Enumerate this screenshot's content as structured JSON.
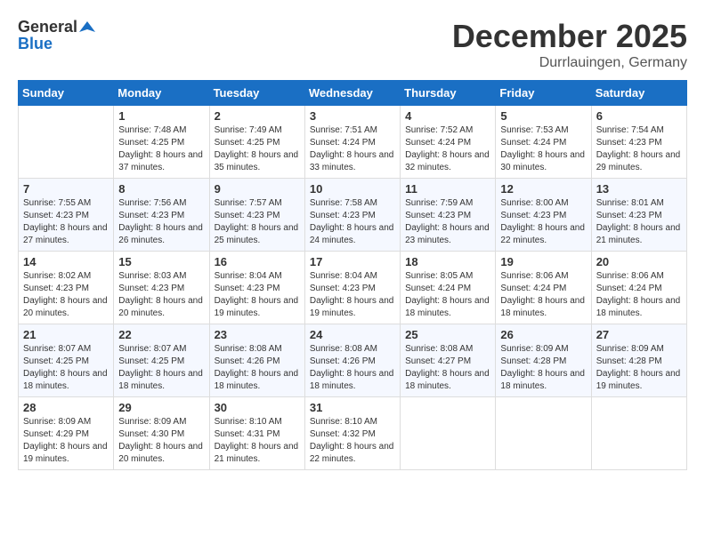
{
  "header": {
    "logo_general": "General",
    "logo_blue": "Blue",
    "month_title": "December 2025",
    "location": "Durrlauingen, Germany"
  },
  "days_of_week": [
    "Sunday",
    "Monday",
    "Tuesday",
    "Wednesday",
    "Thursday",
    "Friday",
    "Saturday"
  ],
  "weeks": [
    [
      {
        "day": "",
        "sunrise": "",
        "sunset": "",
        "daylight": ""
      },
      {
        "day": "1",
        "sunrise": "Sunrise: 7:48 AM",
        "sunset": "Sunset: 4:25 PM",
        "daylight": "Daylight: 8 hours and 37 minutes."
      },
      {
        "day": "2",
        "sunrise": "Sunrise: 7:49 AM",
        "sunset": "Sunset: 4:25 PM",
        "daylight": "Daylight: 8 hours and 35 minutes."
      },
      {
        "day": "3",
        "sunrise": "Sunrise: 7:51 AM",
        "sunset": "Sunset: 4:24 PM",
        "daylight": "Daylight: 8 hours and 33 minutes."
      },
      {
        "day": "4",
        "sunrise": "Sunrise: 7:52 AM",
        "sunset": "Sunset: 4:24 PM",
        "daylight": "Daylight: 8 hours and 32 minutes."
      },
      {
        "day": "5",
        "sunrise": "Sunrise: 7:53 AM",
        "sunset": "Sunset: 4:24 PM",
        "daylight": "Daylight: 8 hours and 30 minutes."
      },
      {
        "day": "6",
        "sunrise": "Sunrise: 7:54 AM",
        "sunset": "Sunset: 4:23 PM",
        "daylight": "Daylight: 8 hours and 29 minutes."
      }
    ],
    [
      {
        "day": "7",
        "sunrise": "Sunrise: 7:55 AM",
        "sunset": "Sunset: 4:23 PM",
        "daylight": "Daylight: 8 hours and 27 minutes."
      },
      {
        "day": "8",
        "sunrise": "Sunrise: 7:56 AM",
        "sunset": "Sunset: 4:23 PM",
        "daylight": "Daylight: 8 hours and 26 minutes."
      },
      {
        "day": "9",
        "sunrise": "Sunrise: 7:57 AM",
        "sunset": "Sunset: 4:23 PM",
        "daylight": "Daylight: 8 hours and 25 minutes."
      },
      {
        "day": "10",
        "sunrise": "Sunrise: 7:58 AM",
        "sunset": "Sunset: 4:23 PM",
        "daylight": "Daylight: 8 hours and 24 minutes."
      },
      {
        "day": "11",
        "sunrise": "Sunrise: 7:59 AM",
        "sunset": "Sunset: 4:23 PM",
        "daylight": "Daylight: 8 hours and 23 minutes."
      },
      {
        "day": "12",
        "sunrise": "Sunrise: 8:00 AM",
        "sunset": "Sunset: 4:23 PM",
        "daylight": "Daylight: 8 hours and 22 minutes."
      },
      {
        "day": "13",
        "sunrise": "Sunrise: 8:01 AM",
        "sunset": "Sunset: 4:23 PM",
        "daylight": "Daylight: 8 hours and 21 minutes."
      }
    ],
    [
      {
        "day": "14",
        "sunrise": "Sunrise: 8:02 AM",
        "sunset": "Sunset: 4:23 PM",
        "daylight": "Daylight: 8 hours and 20 minutes."
      },
      {
        "day": "15",
        "sunrise": "Sunrise: 8:03 AM",
        "sunset": "Sunset: 4:23 PM",
        "daylight": "Daylight: 8 hours and 20 minutes."
      },
      {
        "day": "16",
        "sunrise": "Sunrise: 8:04 AM",
        "sunset": "Sunset: 4:23 PM",
        "daylight": "Daylight: 8 hours and 19 minutes."
      },
      {
        "day": "17",
        "sunrise": "Sunrise: 8:04 AM",
        "sunset": "Sunset: 4:23 PM",
        "daylight": "Daylight: 8 hours and 19 minutes."
      },
      {
        "day": "18",
        "sunrise": "Sunrise: 8:05 AM",
        "sunset": "Sunset: 4:24 PM",
        "daylight": "Daylight: 8 hours and 18 minutes."
      },
      {
        "day": "19",
        "sunrise": "Sunrise: 8:06 AM",
        "sunset": "Sunset: 4:24 PM",
        "daylight": "Daylight: 8 hours and 18 minutes."
      },
      {
        "day": "20",
        "sunrise": "Sunrise: 8:06 AM",
        "sunset": "Sunset: 4:24 PM",
        "daylight": "Daylight: 8 hours and 18 minutes."
      }
    ],
    [
      {
        "day": "21",
        "sunrise": "Sunrise: 8:07 AM",
        "sunset": "Sunset: 4:25 PM",
        "daylight": "Daylight: 8 hours and 18 minutes."
      },
      {
        "day": "22",
        "sunrise": "Sunrise: 8:07 AM",
        "sunset": "Sunset: 4:25 PM",
        "daylight": "Daylight: 8 hours and 18 minutes."
      },
      {
        "day": "23",
        "sunrise": "Sunrise: 8:08 AM",
        "sunset": "Sunset: 4:26 PM",
        "daylight": "Daylight: 8 hours and 18 minutes."
      },
      {
        "day": "24",
        "sunrise": "Sunrise: 8:08 AM",
        "sunset": "Sunset: 4:26 PM",
        "daylight": "Daylight: 8 hours and 18 minutes."
      },
      {
        "day": "25",
        "sunrise": "Sunrise: 8:08 AM",
        "sunset": "Sunset: 4:27 PM",
        "daylight": "Daylight: 8 hours and 18 minutes."
      },
      {
        "day": "26",
        "sunrise": "Sunrise: 8:09 AM",
        "sunset": "Sunset: 4:28 PM",
        "daylight": "Daylight: 8 hours and 18 minutes."
      },
      {
        "day": "27",
        "sunrise": "Sunrise: 8:09 AM",
        "sunset": "Sunset: 4:28 PM",
        "daylight": "Daylight: 8 hours and 19 minutes."
      }
    ],
    [
      {
        "day": "28",
        "sunrise": "Sunrise: 8:09 AM",
        "sunset": "Sunset: 4:29 PM",
        "daylight": "Daylight: 8 hours and 19 minutes."
      },
      {
        "day": "29",
        "sunrise": "Sunrise: 8:09 AM",
        "sunset": "Sunset: 4:30 PM",
        "daylight": "Daylight: 8 hours and 20 minutes."
      },
      {
        "day": "30",
        "sunrise": "Sunrise: 8:10 AM",
        "sunset": "Sunset: 4:31 PM",
        "daylight": "Daylight: 8 hours and 21 minutes."
      },
      {
        "day": "31",
        "sunrise": "Sunrise: 8:10 AM",
        "sunset": "Sunset: 4:32 PM",
        "daylight": "Daylight: 8 hours and 22 minutes."
      },
      {
        "day": "",
        "sunrise": "",
        "sunset": "",
        "daylight": ""
      },
      {
        "day": "",
        "sunrise": "",
        "sunset": "",
        "daylight": ""
      },
      {
        "day": "",
        "sunrise": "",
        "sunset": "",
        "daylight": ""
      }
    ]
  ]
}
